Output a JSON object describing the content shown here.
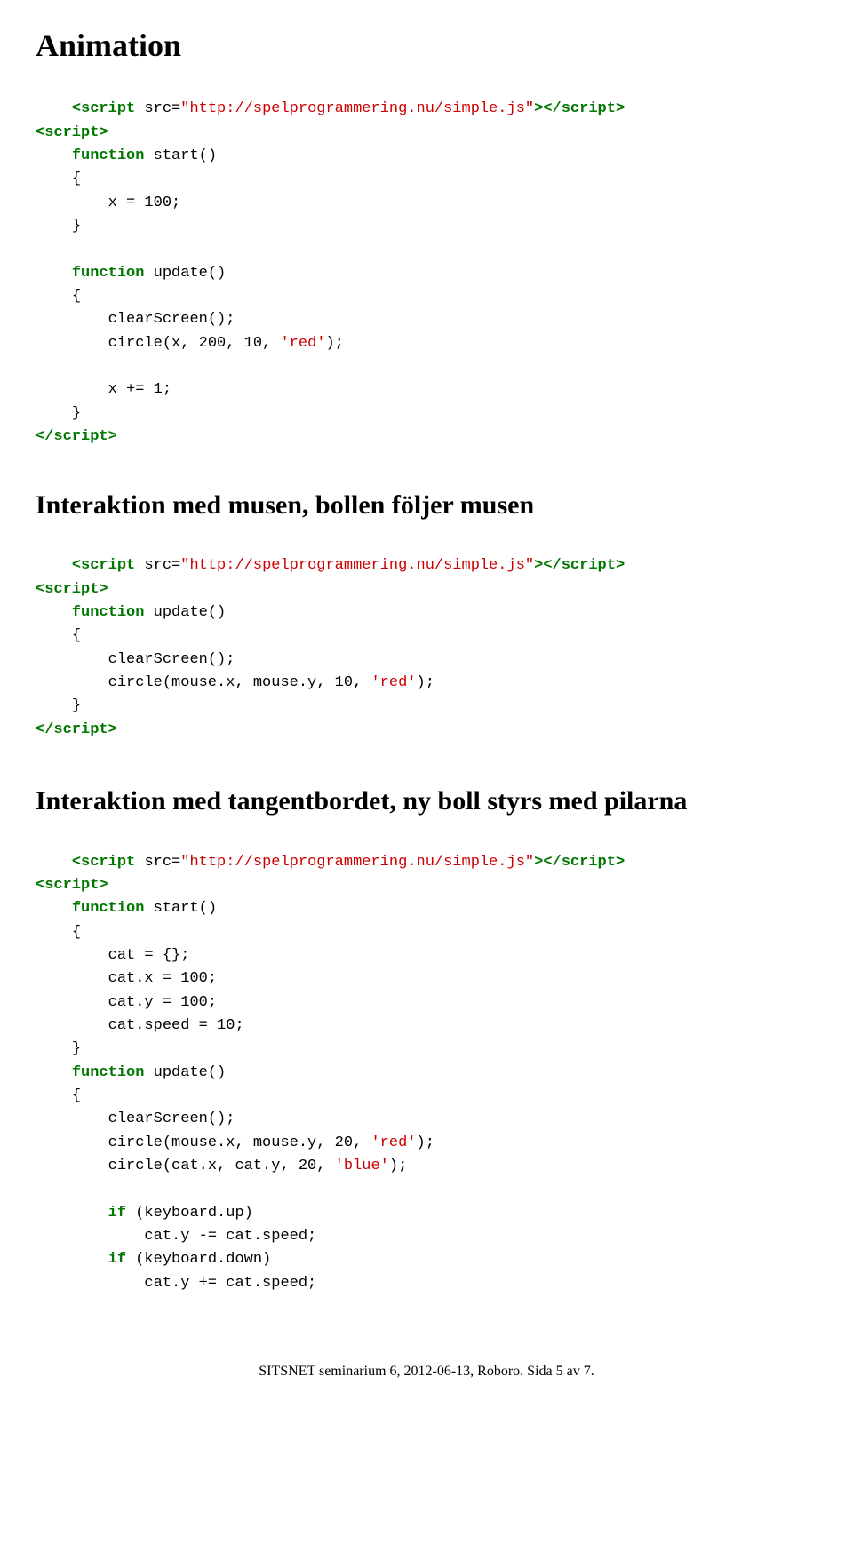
{
  "page": {
    "title": "Animation",
    "section1": {
      "heading": "Animation",
      "code_lines": [
        {
          "type": "tag_line",
          "content": "<script src=\"http://spelprogrammering.nu/simple.js\"><\\/script>"
        },
        {
          "type": "tag_line",
          "content": "<script>"
        },
        {
          "type": "kw_line",
          "keyword": "function",
          "rest": " start()"
        },
        {
          "type": "normal",
          "content": "    {"
        },
        {
          "type": "normal",
          "content": "        x = 100;"
        },
        {
          "type": "normal",
          "content": "    }"
        },
        {
          "type": "blank"
        },
        {
          "type": "kw_line",
          "keyword": "function",
          "rest": " update()"
        },
        {
          "type": "normal",
          "content": "    {"
        },
        {
          "type": "normal",
          "content": "        clearScreen();"
        },
        {
          "type": "normal",
          "content": "        circle(x, 200, 10, "
        },
        {
          "type": "normal",
          "content": "        x += 1;"
        },
        {
          "type": "normal",
          "content": "    }"
        },
        {
          "type": "tag_line",
          "content": "<\\/script>"
        }
      ]
    },
    "section2": {
      "heading": "Interaktion med musen, bollen följer musen",
      "code_lines": [
        {
          "type": "tag_line",
          "content": "<script src=\"http://spelprogrammering.nu/simple.js\"><\\/script>"
        },
        {
          "type": "tag_line",
          "content": "<script>"
        },
        {
          "type": "kw_line",
          "keyword": "function",
          "rest": " update()"
        },
        {
          "type": "normal",
          "content": "    {"
        },
        {
          "type": "normal",
          "content": "        clearScreen();"
        },
        {
          "type": "tag_line",
          "content": "<\\/script>"
        }
      ]
    },
    "section3": {
      "heading": "Interaktion med tangentbordet, ny boll styrs med pilarna",
      "code_lines": [
        {
          "type": "tag_line",
          "content": "<script src=\"http://spelprogrammering.nu/simple.js\"><\\/script>"
        },
        {
          "type": "tag_line",
          "content": "<script>"
        },
        {
          "type": "kw_line",
          "keyword": "function",
          "rest": " start()"
        },
        {
          "type": "normal",
          "content": "    {"
        },
        {
          "type": "normal",
          "content": "        cat = {};"
        },
        {
          "type": "normal",
          "content": "        cat.x = 100;"
        },
        {
          "type": "normal",
          "content": "        cat.y = 100;"
        },
        {
          "type": "normal",
          "content": "        cat.speed = 10;"
        },
        {
          "type": "normal",
          "content": "    }"
        },
        {
          "type": "kw_line",
          "keyword": "function",
          "rest": " update()"
        },
        {
          "type": "normal",
          "content": "    {"
        },
        {
          "type": "normal",
          "content": "        clearScreen();"
        },
        {
          "type": "normal",
          "content": "        circle(mouse.x, mouse.y, 20, 'red');"
        },
        {
          "type": "normal",
          "content": "        circle(cat.x, cat.y, 20, 'blue');"
        },
        {
          "type": "blank"
        },
        {
          "type": "kw_if",
          "keyword": "if",
          "rest": " (keyboard.up)"
        },
        {
          "type": "normal",
          "content": "            cat.y -= cat.speed;"
        },
        {
          "type": "kw_if",
          "keyword": "if",
          "rest": " (keyboard.down)"
        },
        {
          "type": "normal",
          "content": "            cat.y += cat.speed;"
        }
      ]
    },
    "footer": "SITSNET seminarium 6, 2012-06-13, Roboro. Sida 5 av 7."
  }
}
